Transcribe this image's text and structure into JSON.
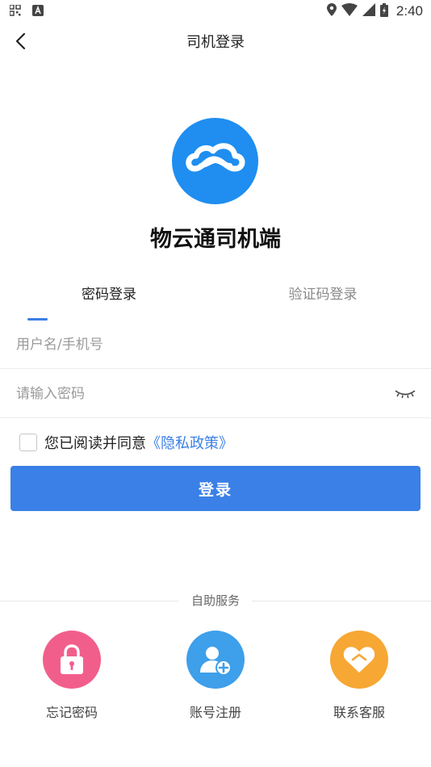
{
  "status_bar": {
    "time": "2:40",
    "icons": [
      "qr-icon",
      "a-badge-icon",
      "location-icon",
      "wifi-icon",
      "signal-icon",
      "battery-icon"
    ]
  },
  "nav": {
    "title": "司机登录",
    "back_icon": "chevron-left-icon"
  },
  "app": {
    "name": "物云通司机端",
    "logo_color": "#1f8ef0"
  },
  "tabs": [
    {
      "label": "密码登录",
      "active": true
    },
    {
      "label": "验证码登录",
      "active": false
    }
  ],
  "form": {
    "username_placeholder": "用户名/手机号",
    "password_placeholder": "请输入密码"
  },
  "agreement": {
    "text": "您已阅读并同意",
    "link": "《隐私政策》",
    "checked": false
  },
  "login_button": {
    "label": "登录",
    "color": "#3a80e6"
  },
  "self_service": {
    "title": "自助服务",
    "items": [
      {
        "label": "忘记密码",
        "icon": "lock-icon",
        "color": "#f25e8c"
      },
      {
        "label": "账号注册",
        "icon": "user-add-icon",
        "color": "#3e9fea"
      },
      {
        "label": "联系客服",
        "icon": "heart-tag-icon",
        "color": "#f7a733"
      }
    ]
  }
}
